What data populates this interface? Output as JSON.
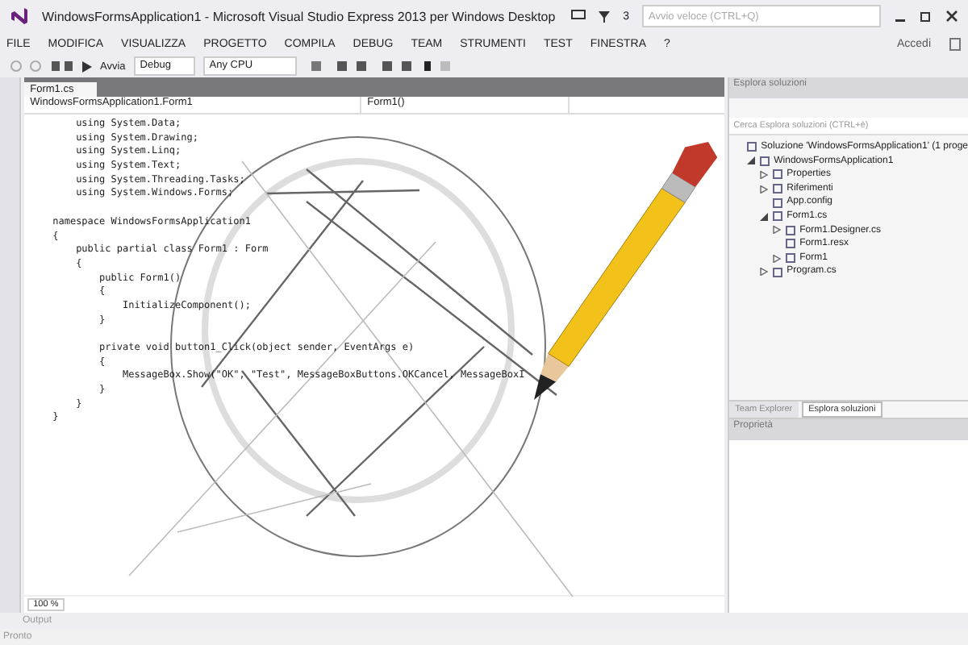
{
  "window": {
    "title": "WindowsFormsApplication1 - Microsoft Visual Studio Express 2013 per Windows Desktop",
    "notification_count": "3",
    "quick_launch": {
      "placeholder": "Avvio veloce (CTRL+Q)"
    },
    "sign_in": "Accedi"
  },
  "menu": [
    "FILE",
    "MODIFICA",
    "VISUALIZZA",
    "PROGETTO",
    "COMPILA",
    "DEBUG",
    "TEAM",
    "STRUMENTI",
    "TEST",
    "FINESTRA",
    "?"
  ],
  "toolbar": {
    "start": "Avvia",
    "configuration": "Debug",
    "platform": "Any CPU"
  },
  "editor": {
    "tab": "Form1.cs",
    "class_dropdown": "WindowsFormsApplication1.Form1",
    "member_dropdown": "Form1()",
    "zoom": "100 %",
    "lines": [
      {
        "text": "    using System.Data;"
      },
      {
        "text": "    using System.Drawing;"
      },
      {
        "text": "    using System.Linq;"
      },
      {
        "text": "    using System.Text;"
      },
      {
        "text": "    using System.Threading.Tasks;"
      },
      {
        "text": "    using System.Windows.Forms;"
      },
      {
        "text": "namespace WindowsFormsApplication1",
        "gap_before": true
      },
      {
        "text": "{"
      },
      {
        "text": "    public partial class Form1 : Form"
      },
      {
        "text": "    {"
      },
      {
        "text": "        public Form1()"
      },
      {
        "text": "        {"
      },
      {
        "text": "            InitializeComponent();"
      },
      {
        "text": "        }"
      },
      {
        "text": "        private void button1_Click(object sender, EventArgs e)",
        "gap_before": true
      },
      {
        "text": "        {"
      },
      {
        "text": "            MessageBox.Show(\"OK\", \"Test\", MessageBoxButtons.OKCancel, MessageBoxI"
      },
      {
        "text": "        }"
      },
      {
        "text": "    }"
      },
      {
        "text": "}"
      }
    ]
  },
  "solution_explorer": {
    "title": "Esplora soluzioni",
    "search": {
      "placeholder": "Cerca Esplora soluzioni (CTRL+è)"
    },
    "tree": [
      {
        "label": "Soluzione 'WindowsFormsApplication1' (1 proge",
        "children": [
          {
            "label": "WindowsFormsApplication1",
            "expanded": true,
            "children": [
              {
                "label": "Properties",
                "expanded": false
              },
              {
                "label": "Riferimenti",
                "expanded": false
              },
              {
                "label": "App.config"
              },
              {
                "label": "Form1.cs",
                "expanded": true,
                "children": [
                  {
                    "label": "Form1.Designer.cs",
                    "expanded": false
                  },
                  {
                    "label": "Form1.resx"
                  },
                  {
                    "label": "Form1",
                    "expanded": false
                  }
                ]
              },
              {
                "label": "Program.cs",
                "expanded": false
              }
            ]
          }
        ]
      }
    ],
    "tabs": [
      {
        "label": "Team Explorer",
        "selected": false
      },
      {
        "label": "Esplora soluzioni",
        "selected": true
      }
    ]
  },
  "properties": {
    "title": "Proprietà"
  },
  "bottom_tabs": [
    "Output"
  ],
  "status_bar": {
    "text": "Pronto"
  }
}
